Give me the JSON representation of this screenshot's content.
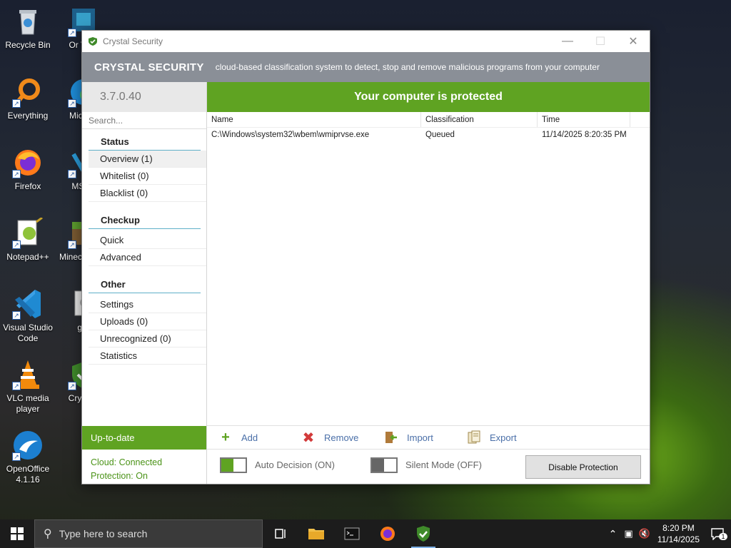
{
  "desktop": {
    "icons_col1": [
      {
        "label": "Recycle Bin",
        "icon": "recycle-bin-icon"
      },
      {
        "label": "Everything",
        "icon": "everything-icon"
      },
      {
        "label": "Firefox",
        "icon": "firefox-icon"
      },
      {
        "label": "Notepad++",
        "icon": "notepad-plus-plus-icon"
      },
      {
        "label": "Visual Studio Code",
        "icon": "vscode-icon"
      },
      {
        "label": "VLC media player",
        "icon": "vlc-icon"
      },
      {
        "label": "OpenOffice 4.1.16",
        "icon": "openoffice-icon"
      }
    ],
    "icons_col2": [
      {
        "label": "Or Virtu",
        "icon": "virtualbox-icon"
      },
      {
        "label": "Micr Ec",
        "icon": "edge-icon"
      },
      {
        "label": "MSN I",
        "icon": "msn-icon"
      },
      {
        "label": "Minec Game",
        "icon": "minecraft-icon"
      },
      {
        "label": "gar",
        "icon": "generic-file-icon"
      },
      {
        "label": "Cry Sec",
        "icon": "crystal-security-icon"
      }
    ]
  },
  "window": {
    "title": "Crystal Security",
    "brand": "CRYSTAL SECURITY",
    "tagline": "cloud-based classification system to detect, stop and remove malicious programs from your computer",
    "version": "3.7.0.40",
    "search_placeholder": "Search...",
    "status_banner": "Your computer is protected",
    "sections": [
      {
        "heading": "Status",
        "items": [
          "Overview (1)",
          "Whitelist (0)",
          "Blacklist (0)"
        ]
      },
      {
        "heading": "Checkup",
        "items": [
          "Quick",
          "Advanced"
        ]
      },
      {
        "heading": "Other",
        "items": [
          "Settings",
          "Uploads (0)",
          "Unrecognized (0)",
          "Statistics"
        ]
      }
    ],
    "update_status": "Up-to-date",
    "cloud_status": "Cloud: Connected",
    "protection_status": "Protection: On",
    "table": {
      "columns": [
        "Name",
        "Classification",
        "Time"
      ],
      "rows": [
        [
          "C:\\Windows\\system32\\wbem\\wmiprvse.exe",
          "Queued",
          "11/14/2025 8:20:35 PM"
        ]
      ]
    },
    "toolbar": {
      "add": "Add",
      "remove": "Remove",
      "import": "Import",
      "export": "Export"
    },
    "auto_decision": "Auto Decision (ON)",
    "silent_mode": "Silent Mode (OFF)",
    "disable_button": "Disable Protection",
    "colors": {
      "accent_green": "#5fa322",
      "banner_gray": "#8a8f97"
    }
  },
  "taskbar": {
    "search_placeholder": "Type here to search",
    "time": "8:20 PM",
    "date": "11/14/2025",
    "notification_count": "1"
  }
}
